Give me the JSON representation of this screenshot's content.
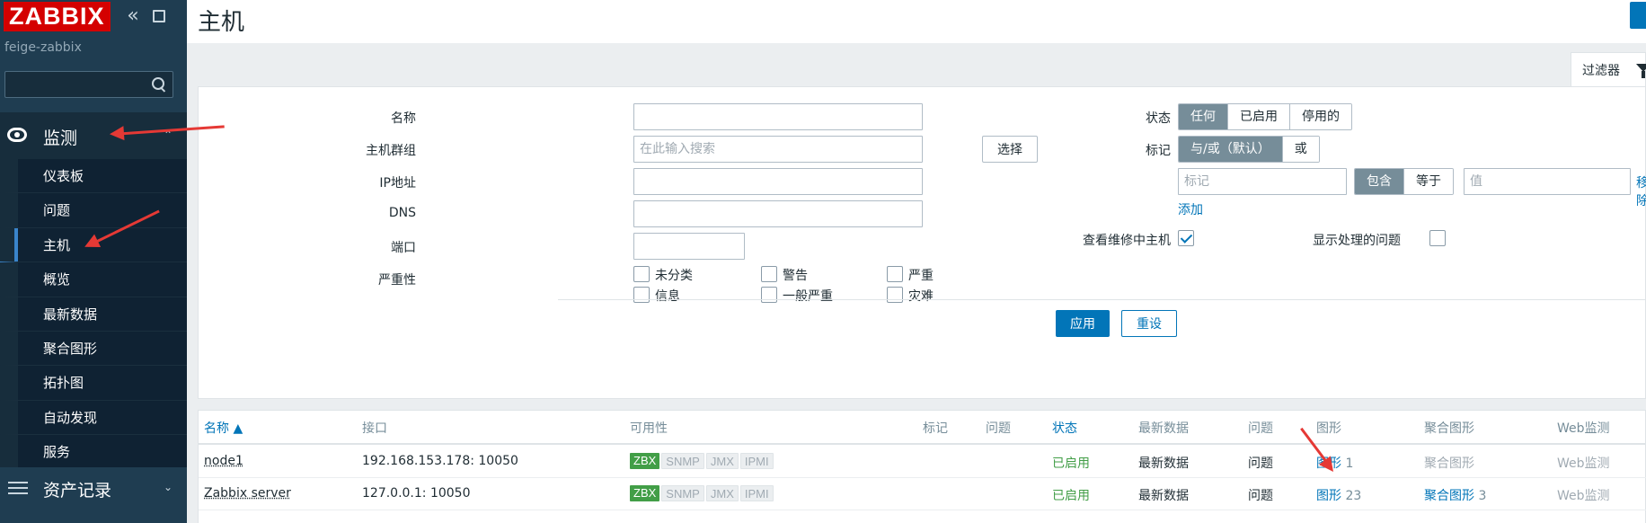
{
  "sidebar": {
    "logo": "ZABBIX",
    "server_name": "feige-zabbix",
    "search_placeholder": "",
    "monitoring_label": "监测",
    "monitoring_items": [
      {
        "label": "仪表板"
      },
      {
        "label": "问题"
      },
      {
        "label": "主机"
      },
      {
        "label": "概览"
      },
      {
        "label": "最新数据"
      },
      {
        "label": "聚合图形"
      },
      {
        "label": "拓扑图"
      },
      {
        "label": "自动发现"
      },
      {
        "label": "服务"
      }
    ],
    "active_item": "主机",
    "inventory_label": "资产记录"
  },
  "header": {
    "title": "主机"
  },
  "filter": {
    "tab_label": "过滤器",
    "name_label": "名称",
    "name_value": "",
    "hostgroup_label": "主机群组",
    "hostgroup_placeholder": "在此输入搜索",
    "select_button": "选择",
    "ip_label": "IP地址",
    "ip_value": "",
    "dns_label": "DNS",
    "dns_value": "",
    "port_label": "端口",
    "port_value": "",
    "severity_label": "严重性",
    "severities": [
      "未分类",
      "警告",
      "严重",
      "信息",
      "一般严重",
      "灾难"
    ],
    "status_label": "状态",
    "status_options": [
      "任何",
      "已启用",
      "停用的"
    ],
    "status_selected": "任何",
    "tags_label": "标记",
    "tag_operator_options": [
      "与/或（默认）",
      "或"
    ],
    "tag_operator_selected": "与/或（默认）",
    "tag_placeholder": "标记",
    "tag_match_options": [
      "包含",
      "等于"
    ],
    "tag_match_selected": "包含",
    "value_placeholder": "值",
    "remove_link": "移除",
    "add_link": "添加",
    "maintenance_label": "查看维修中主机",
    "maintenance_checked": true,
    "suppressed_label": "显示处理的问题",
    "suppressed_checked": false,
    "apply_button": "应用",
    "reset_button": "重设"
  },
  "table": {
    "columns": [
      "名称 ▲",
      "接口",
      "可用性",
      "标记",
      "问题",
      "状态",
      "最新数据",
      "问题",
      "图形",
      "聚合图形",
      "Web监测"
    ],
    "rows": [
      {
        "name": "node1",
        "interface": "192.168.153.178: 10050",
        "availability": [
          "ZBX",
          "SNMP",
          "JMX",
          "IPMI"
        ],
        "status": "已启用",
        "latest_data": "最新数据",
        "problems": "问题",
        "graphs": "图形",
        "graphs_count": "1",
        "screens": "聚合图形",
        "screens_count": "",
        "web": "Web监测"
      },
      {
        "name": "Zabbix server",
        "interface": "127.0.0.1: 10050",
        "availability": [
          "ZBX",
          "SNMP",
          "JMX",
          "IPMI"
        ],
        "status": "已启用",
        "latest_data": "最新数据",
        "problems": "问题",
        "graphs": "图形",
        "graphs_count": "23",
        "screens": "聚合图形",
        "screens_count": "3",
        "web": "Web监测"
      }
    ]
  },
  "colors": {
    "sidebar_bg": "#1f3d51",
    "accent": "#0275b8",
    "logo_red": "#d40000",
    "enabled_green": "#429e47",
    "annotation_red": "#e53935"
  }
}
